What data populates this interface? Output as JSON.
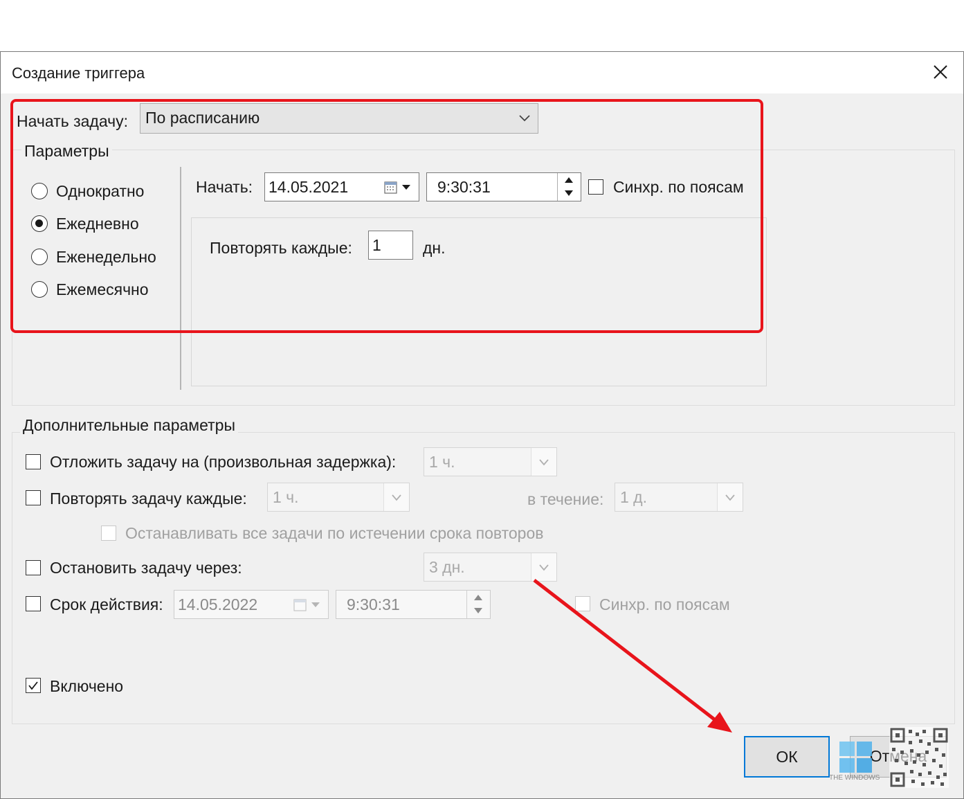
{
  "window": {
    "title": "Создание триггера"
  },
  "begin_task": {
    "label": "Начать задачу:",
    "value": "По расписанию"
  },
  "params": {
    "group_label": "Параметры",
    "options": [
      {
        "label": "Однократно",
        "selected": false
      },
      {
        "label": "Ежедневно",
        "selected": true
      },
      {
        "label": "Еженедельно",
        "selected": false
      },
      {
        "label": "Ежемесячно",
        "selected": false
      }
    ],
    "start_label": "Начать:",
    "start_date": "14.05.2021",
    "start_time": "9:30:31",
    "sync_label": "Синхр. по поясам",
    "repeat_label": "Повторять каждые:",
    "repeat_value": "1",
    "repeat_unit": "дн."
  },
  "advanced": {
    "group_label": "Дополнительные параметры",
    "delay_label": "Отложить задачу на (произвольная задержка):",
    "delay_value": "1 ч.",
    "repeat_label": "Повторять задачу каждые:",
    "repeat_value": "1 ч.",
    "duration_label": "в течение:",
    "duration_value": "1 д.",
    "stop_all_label": "Останавливать все задачи по истечении срока повторов",
    "stop_after_label": "Остановить задачу через:",
    "stop_after_value": "3 дн.",
    "expire_label": "Срок действия:",
    "expire_date": "14.05.2022",
    "expire_time": "9:30:31",
    "expire_sync_label": "Синхр. по поясам",
    "enabled_label": "Включено",
    "enabled_checked": true
  },
  "buttons": {
    "ok": "ОК",
    "cancel": "Отмена"
  },
  "watermark": {
    "text": "THE WINDOWS"
  },
  "colors": {
    "highlight": "#e8141b",
    "accent": "#0078d7"
  }
}
